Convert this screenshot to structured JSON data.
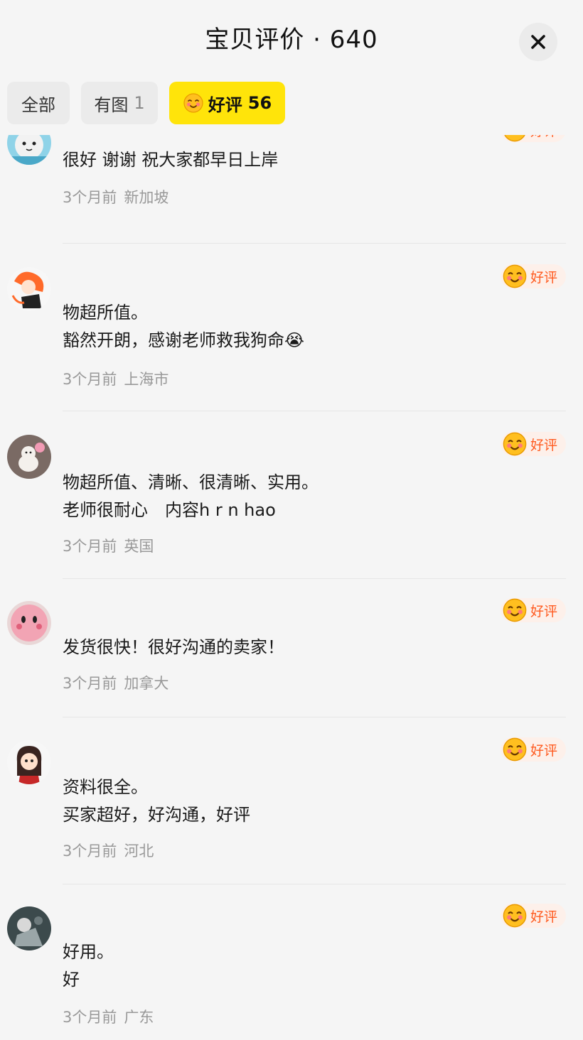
{
  "header": {
    "title": "宝贝评价 · 640",
    "close_icon": "close-icon"
  },
  "tabs": [
    {
      "label": "全部",
      "count": "",
      "active": false
    },
    {
      "label": "有图",
      "count": "1",
      "active": false
    },
    {
      "label": "好评",
      "count": "56",
      "active": true,
      "icon": "smiling-face-icon"
    }
  ],
  "badge_label": "好评",
  "colors": {
    "accent_yellow": "#ffe40a",
    "badge_orange": "#ff5a1f",
    "badge_bg": "#fdf0ea",
    "meta_gray": "#999999"
  },
  "reviews": [
    {
      "lines": [
        "很好 谢谢 祝大家都早日上岸"
      ],
      "time": "3个月前",
      "location": "新加坡"
    },
    {
      "lines": [
        "物超所值。",
        "豁然开朗，感谢老师救我狗命😭"
      ],
      "time": "3个月前",
      "location": "上海市"
    },
    {
      "lines": [
        "物超所值、清晰、很清晰、实用。",
        "老师很耐心　内容h r n hao"
      ],
      "time": "3个月前",
      "location": "英国"
    },
    {
      "lines": [
        "发货很快！很好沟通的卖家！"
      ],
      "time": "3个月前",
      "location": "加拿大"
    },
    {
      "lines": [
        "资料很全。",
        "买家超好，好沟通，好评"
      ],
      "time": "3个月前",
      "location": "河北"
    },
    {
      "lines": [
        "好用。",
        "好"
      ],
      "time": "3个月前",
      "location": "广东"
    }
  ]
}
